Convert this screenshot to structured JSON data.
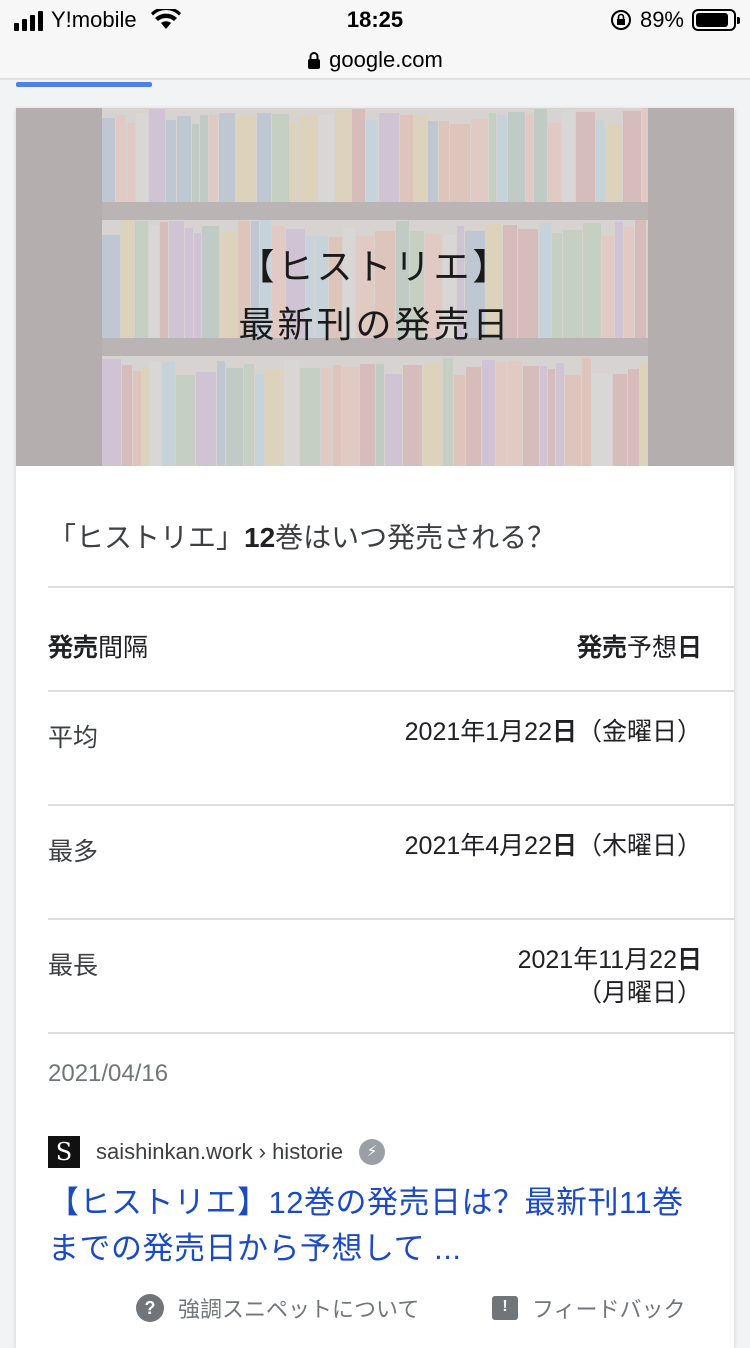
{
  "status_bar": {
    "carrier": "Y!mobile",
    "time": "18:25",
    "battery_percent": "89%",
    "battery_level": 0.89
  },
  "url_bar": {
    "domain": "google.com"
  },
  "hero": {
    "line1": "【ヒストリエ】",
    "line2": "最新刊の発売日"
  },
  "snippet": {
    "question_prefix": "「ヒストリエ」",
    "question_bold": "12",
    "question_suffix": "巻はいつ発売される？",
    "table": {
      "header_left_bold": "発売",
      "header_left_rest": "間隔",
      "header_right_bold": "発売",
      "header_right_mid": "予想",
      "header_right_bold2": "日",
      "rows": [
        {
          "label": "平均",
          "value_date": "2021年1月22",
          "value_bold": "日",
          "value_day": "（金曜日）"
        },
        {
          "label": "最多",
          "value_date": "2021年4月22",
          "value_bold": "日",
          "value_day": "（木曜日）"
        },
        {
          "label": "最長",
          "value_date": "2021年11月22",
          "value_bold": "日",
          "value_day": "（月曜日）"
        }
      ]
    },
    "date": "2021/04/16",
    "favicon_letter": "S",
    "cite": "saishinkan.work › historie",
    "title": "【ヒストリエ】12巻の発売日は？最新刊11巻までの発売日から予想して ...",
    "about_label": "強調スニペットについて",
    "feedback_label": "フィードバック"
  }
}
